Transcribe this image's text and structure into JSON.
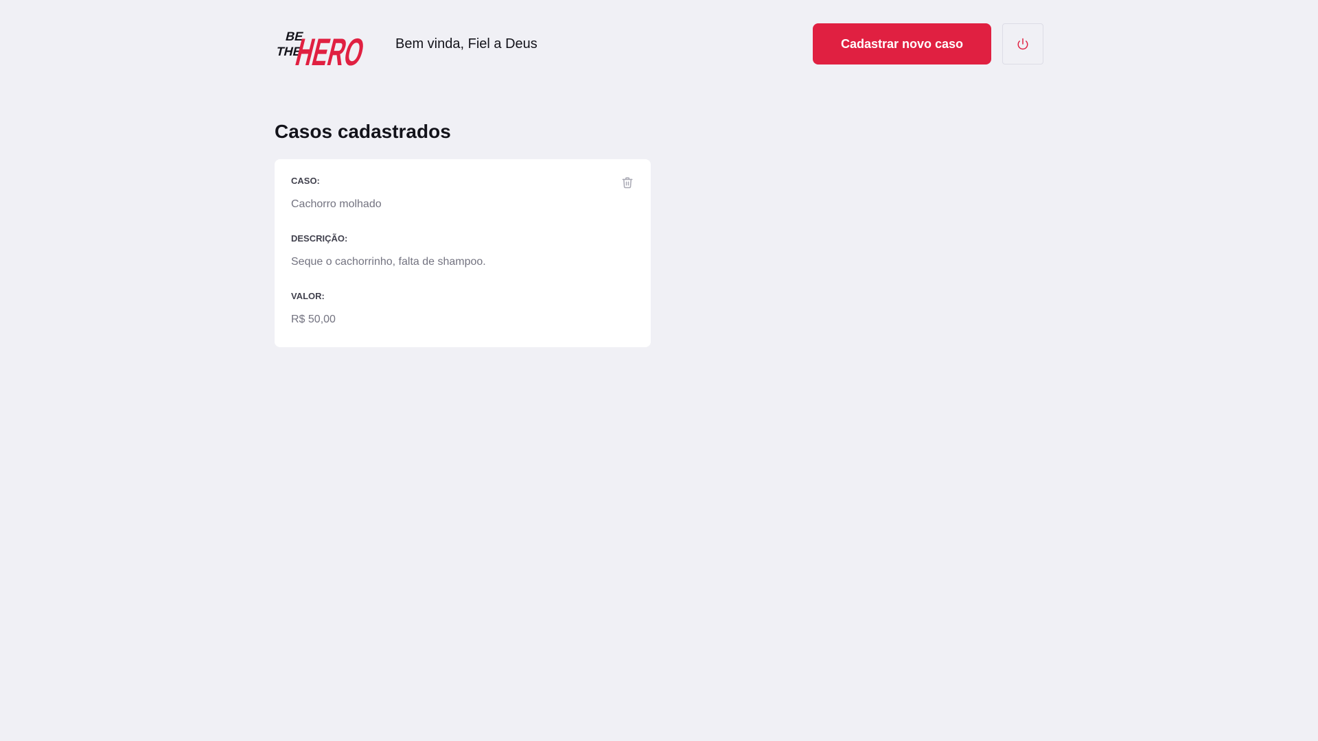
{
  "header": {
    "logo_text": [
      "BE",
      "THE",
      "HERO"
    ],
    "welcome": "Bem vinda, Fiel a Deus",
    "new_case_label": "Cadastrar novo caso",
    "logout_icon": "power-icon"
  },
  "main": {
    "title": "Casos cadastrados",
    "cases": [
      {
        "case_label": "CASO:",
        "case_value": "Cachorro molhado",
        "description_label": "DESCRIÇÃO:",
        "description_value": "Seque o cachorrinho, falta de shampoo.",
        "value_label": "VALOR:",
        "value_value": "R$ 50,00",
        "delete_icon": "trash-icon"
      }
    ]
  },
  "colors": {
    "brand": "#e02041",
    "background": "#f0f0f5",
    "card": "#ffffff",
    "label": "#41414d",
    "muted": "#737380",
    "icon": "#a8a8b3"
  }
}
